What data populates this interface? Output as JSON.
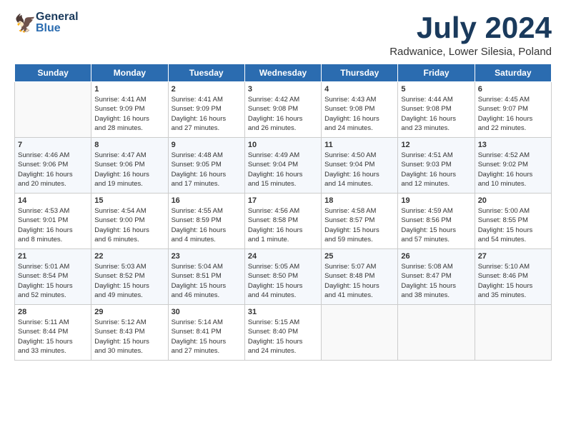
{
  "header": {
    "logo_general": "General",
    "logo_blue": "Blue",
    "month_title": "July 2024",
    "location": "Radwanice, Lower Silesia, Poland"
  },
  "days_of_week": [
    "Sunday",
    "Monday",
    "Tuesday",
    "Wednesday",
    "Thursday",
    "Friday",
    "Saturday"
  ],
  "weeks": [
    [
      {
        "day": "",
        "info": ""
      },
      {
        "day": "1",
        "info": "Sunrise: 4:41 AM\nSunset: 9:09 PM\nDaylight: 16 hours\nand 28 minutes."
      },
      {
        "day": "2",
        "info": "Sunrise: 4:41 AM\nSunset: 9:09 PM\nDaylight: 16 hours\nand 27 minutes."
      },
      {
        "day": "3",
        "info": "Sunrise: 4:42 AM\nSunset: 9:08 PM\nDaylight: 16 hours\nand 26 minutes."
      },
      {
        "day": "4",
        "info": "Sunrise: 4:43 AM\nSunset: 9:08 PM\nDaylight: 16 hours\nand 24 minutes."
      },
      {
        "day": "5",
        "info": "Sunrise: 4:44 AM\nSunset: 9:08 PM\nDaylight: 16 hours\nand 23 minutes."
      },
      {
        "day": "6",
        "info": "Sunrise: 4:45 AM\nSunset: 9:07 PM\nDaylight: 16 hours\nand 22 minutes."
      }
    ],
    [
      {
        "day": "7",
        "info": "Sunrise: 4:46 AM\nSunset: 9:06 PM\nDaylight: 16 hours\nand 20 minutes."
      },
      {
        "day": "8",
        "info": "Sunrise: 4:47 AM\nSunset: 9:06 PM\nDaylight: 16 hours\nand 19 minutes."
      },
      {
        "day": "9",
        "info": "Sunrise: 4:48 AM\nSunset: 9:05 PM\nDaylight: 16 hours\nand 17 minutes."
      },
      {
        "day": "10",
        "info": "Sunrise: 4:49 AM\nSunset: 9:04 PM\nDaylight: 16 hours\nand 15 minutes."
      },
      {
        "day": "11",
        "info": "Sunrise: 4:50 AM\nSunset: 9:04 PM\nDaylight: 16 hours\nand 14 minutes."
      },
      {
        "day": "12",
        "info": "Sunrise: 4:51 AM\nSunset: 9:03 PM\nDaylight: 16 hours\nand 12 minutes."
      },
      {
        "day": "13",
        "info": "Sunrise: 4:52 AM\nSunset: 9:02 PM\nDaylight: 16 hours\nand 10 minutes."
      }
    ],
    [
      {
        "day": "14",
        "info": "Sunrise: 4:53 AM\nSunset: 9:01 PM\nDaylight: 16 hours\nand 8 minutes."
      },
      {
        "day": "15",
        "info": "Sunrise: 4:54 AM\nSunset: 9:00 PM\nDaylight: 16 hours\nand 6 minutes."
      },
      {
        "day": "16",
        "info": "Sunrise: 4:55 AM\nSunset: 8:59 PM\nDaylight: 16 hours\nand 4 minutes."
      },
      {
        "day": "17",
        "info": "Sunrise: 4:56 AM\nSunset: 8:58 PM\nDaylight: 16 hours\nand 1 minute."
      },
      {
        "day": "18",
        "info": "Sunrise: 4:58 AM\nSunset: 8:57 PM\nDaylight: 15 hours\nand 59 minutes."
      },
      {
        "day": "19",
        "info": "Sunrise: 4:59 AM\nSunset: 8:56 PM\nDaylight: 15 hours\nand 57 minutes."
      },
      {
        "day": "20",
        "info": "Sunrise: 5:00 AM\nSunset: 8:55 PM\nDaylight: 15 hours\nand 54 minutes."
      }
    ],
    [
      {
        "day": "21",
        "info": "Sunrise: 5:01 AM\nSunset: 8:54 PM\nDaylight: 15 hours\nand 52 minutes."
      },
      {
        "day": "22",
        "info": "Sunrise: 5:03 AM\nSunset: 8:52 PM\nDaylight: 15 hours\nand 49 minutes."
      },
      {
        "day": "23",
        "info": "Sunrise: 5:04 AM\nSunset: 8:51 PM\nDaylight: 15 hours\nand 46 minutes."
      },
      {
        "day": "24",
        "info": "Sunrise: 5:05 AM\nSunset: 8:50 PM\nDaylight: 15 hours\nand 44 minutes."
      },
      {
        "day": "25",
        "info": "Sunrise: 5:07 AM\nSunset: 8:48 PM\nDaylight: 15 hours\nand 41 minutes."
      },
      {
        "day": "26",
        "info": "Sunrise: 5:08 AM\nSunset: 8:47 PM\nDaylight: 15 hours\nand 38 minutes."
      },
      {
        "day": "27",
        "info": "Sunrise: 5:10 AM\nSunset: 8:46 PM\nDaylight: 15 hours\nand 35 minutes."
      }
    ],
    [
      {
        "day": "28",
        "info": "Sunrise: 5:11 AM\nSunset: 8:44 PM\nDaylight: 15 hours\nand 33 minutes."
      },
      {
        "day": "29",
        "info": "Sunrise: 5:12 AM\nSunset: 8:43 PM\nDaylight: 15 hours\nand 30 minutes."
      },
      {
        "day": "30",
        "info": "Sunrise: 5:14 AM\nSunset: 8:41 PM\nDaylight: 15 hours\nand 27 minutes."
      },
      {
        "day": "31",
        "info": "Sunrise: 5:15 AM\nSunset: 8:40 PM\nDaylight: 15 hours\nand 24 minutes."
      },
      {
        "day": "",
        "info": ""
      },
      {
        "day": "",
        "info": ""
      },
      {
        "day": "",
        "info": ""
      }
    ]
  ]
}
